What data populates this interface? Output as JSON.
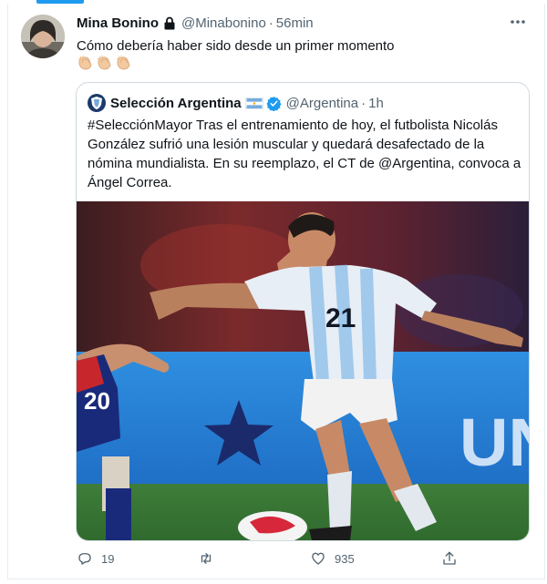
{
  "tweet": {
    "author_name": "Mina Bonino",
    "author_handle": "@Minabonino",
    "separator": "·",
    "time": "56min",
    "text": "Cómo debería haber sido desde un primer momento",
    "emoji_icons": [
      "clapping-hands-icon",
      "clapping-hands-icon",
      "clapping-hands-icon"
    ]
  },
  "quoted": {
    "author_name": "Selección Argentina",
    "author_handle": "@Argentina",
    "separator": "·",
    "time": "1h",
    "text": "#SelecciónMayor Tras el entrenamiento de hoy, el futbolista Nicolás González sufrió una lesión muscular y quedará desafectado de la nómina mundialista. En su reemplazo, el CT de @Argentina,  convoca a Ángel Correa.",
    "photo": {
      "player_number": "21",
      "opponent_number": "20",
      "board_text": "UNA"
    }
  },
  "actions": {
    "reply_count": "19",
    "like_count": "935"
  },
  "colors": {
    "accent": "#1d9bf0",
    "text": "#0f1419",
    "secondary": "#536471",
    "border": "#cfd9de",
    "verified": "#1d9bf0"
  }
}
